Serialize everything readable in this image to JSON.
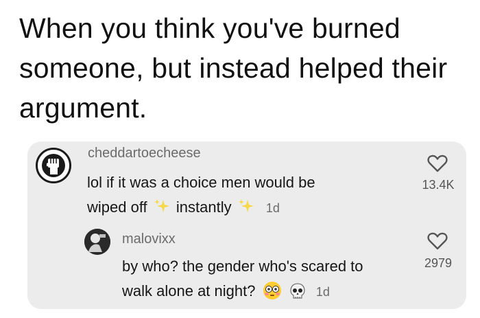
{
  "caption": {
    "line1": "When you think you've burned",
    "line2": "someone, but instead helped their",
    "line3": "argument."
  },
  "comment": {
    "username": "cheddartoecheese",
    "text_line1": "lol if it was a choice men would be",
    "text_line2_part1": "wiped off",
    "text_line2_part2": "instantly",
    "timestamp": "1d",
    "like_count": "13.4K",
    "avatar_icon": "raised-fist-icon"
  },
  "reply": {
    "username": "malovixx",
    "text_line1": "by who? the gender who's scared to",
    "text_line2": "walk alone at night?",
    "timestamp": "1d",
    "like_count": "2979",
    "emojis": [
      "flushed-face-emoji",
      "skull-emoji"
    ]
  },
  "colors": {
    "panel_background": "#ececec",
    "username_gray": "#6b6b6b",
    "sparkle_yellow": "#f5d94a"
  }
}
